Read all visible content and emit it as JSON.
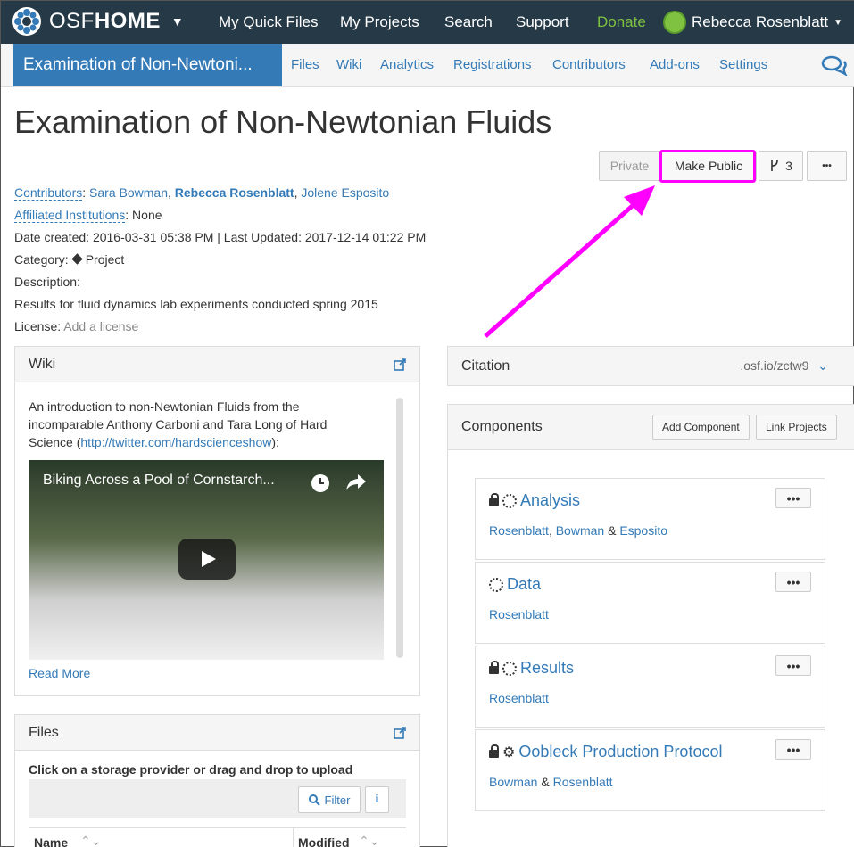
{
  "topnav": {
    "brand_prefix": "OSF",
    "brand_bold": "HOME",
    "links": [
      "My Quick Files",
      "My Projects",
      "Search",
      "Support",
      "Donate"
    ],
    "user": "Rebecca Rosenblatt"
  },
  "subnav": {
    "project_tab": "Examination of Non-Newtoni...",
    "links": [
      "Files",
      "Wiki",
      "Analytics",
      "Registrations",
      "Contributors",
      "Add-ons",
      "Settings"
    ]
  },
  "project": {
    "title": "Examination of Non-Newtonian Fluids",
    "private_label": "Private",
    "make_public_label": "Make Public",
    "fork_count": "3",
    "more_label": "•••",
    "contributors_label": "Contributors",
    "contributors": [
      "Sara Bowman",
      "Rebecca Rosenblatt",
      "Jolene Esposito"
    ],
    "affiliated_label": "Affiliated Institutions",
    "affiliated_value": "None",
    "date_line": "Date created: 2016-03-31 05:38 PM | Last Updated: 2017-12-14 01:22 PM",
    "category_label": "Category:",
    "category_value": "Project",
    "description_label": "Description:",
    "description": "Results for fluid dynamics lab experiments conducted spring 2015",
    "license_label": "License:",
    "license_value": "Add a license"
  },
  "wiki": {
    "title": "Wiki",
    "text_part1": "An introduction to non-Newtonian Fluids from the incomparable Anthony Carboni and Tara Long of Hard Science (",
    "link": "http://twitter.com/hardscienceshow",
    "text_part2": "):",
    "video_title": "Biking Across a Pool of Cornstarch...",
    "read_more": "Read More"
  },
  "files": {
    "title": "Files",
    "instruction": "Click on a storage provider or drag and drop to upload",
    "filter_label": "Filter",
    "col_name": "Name",
    "col_modified": "Modified"
  },
  "citation": {
    "title": "Citation",
    "url": ".osf.io/zctw9"
  },
  "components": {
    "title": "Components",
    "add_label": "Add Component",
    "link_label": "Link Projects",
    "items": [
      {
        "name": "Analysis",
        "contribs": [
          "Rosenblatt",
          "Bowman",
          "Esposito"
        ]
      },
      {
        "name": "Data",
        "contribs": [
          "Rosenblatt"
        ]
      },
      {
        "name": "Results",
        "contribs": [
          "Rosenblatt"
        ]
      },
      {
        "name": "Oobleck Production Protocol",
        "contribs": [
          "Bowman",
          "Rosenblatt"
        ]
      }
    ]
  },
  "colors": {
    "nav": "#263947",
    "accent": "#337ab7",
    "donate": "#7fc241",
    "highlight": "#ff00ff"
  }
}
